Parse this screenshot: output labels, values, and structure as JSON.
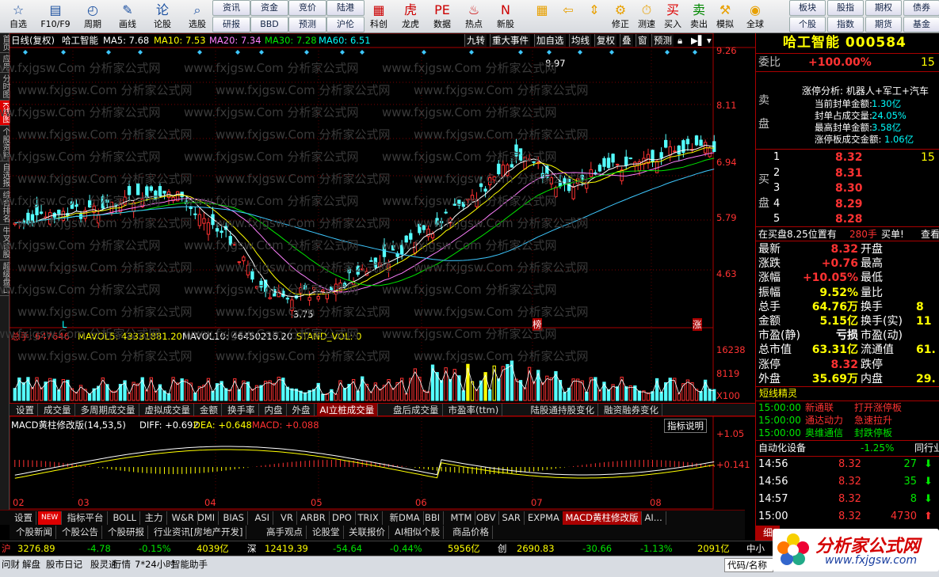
{
  "toolbar": {
    "buttons": [
      {
        "name": "自选",
        "icon": "star"
      },
      {
        "name": "F10/F9",
        "icon": "doc"
      },
      {
        "name": "周期",
        "icon": "clock"
      },
      {
        "name": "画线",
        "icon": "pen"
      },
      {
        "name": "论股",
        "icon": "chat"
      },
      {
        "name": "选股",
        "icon": "search"
      }
    ],
    "small_buttons": [
      "资讯",
      "资金",
      "竞价",
      "陆港",
      "研报",
      "BBD",
      "预测",
      "沪伦"
    ],
    "buttons2": [
      {
        "name": "科创",
        "icon": "chip"
      },
      {
        "name": "龙虎",
        "icon": "tiger"
      },
      {
        "name": "数据",
        "icon": "pe"
      },
      {
        "name": "热点",
        "icon": "fire"
      },
      {
        "name": "新股",
        "icon": "new"
      }
    ],
    "buttons3": [
      {
        "name": "",
        "icon": "grid"
      },
      {
        "name": "",
        "icon": "back"
      },
      {
        "name": "",
        "icon": "updown"
      },
      {
        "name": "修正",
        "icon": "fix"
      },
      {
        "name": "测速",
        "icon": "speed"
      },
      {
        "name": "买入",
        "icon": "buy"
      },
      {
        "name": "卖出",
        "icon": "sell"
      },
      {
        "name": "模拟",
        "icon": "hammer"
      },
      {
        "name": "全球",
        "icon": "globe"
      }
    ],
    "small_buttons2": [
      "板块",
      "股指",
      "期权",
      "债券",
      "个股",
      "指数",
      "期货",
      "基金"
    ]
  },
  "left_tabs": [
    "首页",
    "应用",
    "分时图",
    "K线图",
    "个股资料",
    "自选报",
    "综合排名",
    "牛叉诊股",
    "超级盘口"
  ],
  "chart_header": {
    "mode": "日线(复权)",
    "stock": "哈工智能",
    "ma5": "MA5: 7.68",
    "ma10": "MA10: 7.53",
    "ma20": "MA20: 7.34",
    "ma30": "MA30: 7.28",
    "ma60": "MA60: 6.51"
  },
  "chart_menu": [
    "九转",
    "重大事件",
    "加自选",
    "均线",
    "复权",
    "叠",
    "窗",
    "预测"
  ],
  "price_axis": [
    "9.26",
    "8.11",
    "6.94",
    "5.79",
    "4.63"
  ],
  "annotations": {
    "high": "8.97",
    "low": "3.75",
    "mark_l": "L",
    "mark_bang": "榜",
    "mark_zhang": "涨"
  },
  "volume_header": {
    "label": "总手:",
    "value": "647646",
    "mavol5": "MAVOL5: 43331881.20",
    "mavol10": "MAVOL10: 46450216.20",
    "stand": "STAND_VOL: 0"
  },
  "volume_axis": [
    "16238",
    "8119",
    "X100"
  ],
  "indicator_tabs": [
    "设置",
    "成交量",
    "多周期成交量",
    "虚拟成交量",
    "金额",
    "换手率",
    "内盘",
    "外盘",
    "AI立桩成交量",
    "盘后成交量",
    "市盈率(ttm)",
    "陆股通持股变化",
    "融资融券变化"
  ],
  "macd_header": {
    "title": "MACD黄柱修改版(14,53,5)",
    "diff": "DIFF: +0.692",
    "dea": "DEA: +0.648",
    "macd": "MACD: +0.088",
    "explain": "指标说明"
  },
  "macd_axis": [
    "+1.05",
    "+0.141"
  ],
  "month_labels": [
    "02",
    "03",
    "04",
    "05",
    "06",
    "07",
    "08"
  ],
  "bottom_tabs1": [
    "设置",
    "NEW",
    "指标平台",
    "BOLL",
    "主力",
    "W&R",
    "DMI",
    "BIAS",
    "ASI",
    "VR",
    "ARBR",
    "DPO",
    "TRIX",
    "新DMA",
    "BBI",
    "MTM",
    "OBV",
    "SAR",
    "EXPMA",
    "MACD黄柱修改版",
    "AI..."
  ],
  "bottom_tabs2": [
    "个股新闻",
    "个股公告",
    "个股研报",
    "行业资讯[房地产开发]",
    "高手观点",
    "论股堂",
    "关联报价",
    "AI相似个股",
    "商品价格"
  ],
  "index_bar": {
    "sh_label": "沪",
    "sh_value": "3276.89",
    "sh_change": "-4.78",
    "sh_pct": "-0.15%",
    "sh_amt": "4039亿",
    "sz_label": "深",
    "sz_value": "12419.39",
    "sz_change": "-54.64",
    "sz_pct": "-0.44%",
    "sz_amt": "5956亿",
    "cy_label": "创",
    "cy_value": "2690.83",
    "cy_change": "-30.66",
    "cy_pct": "-1.13%",
    "cy_amt": "2091亿",
    "more": "中小"
  },
  "bottom_bar": [
    "问财",
    "解盘",
    "股市日记",
    "股灵通",
    "行情",
    "7*24小时",
    "智能助手"
  ],
  "bottom_search": "代码/名称",
  "right": {
    "title": "哈工智能 000584",
    "weibi_label": "委比",
    "weibi": "+100.00%",
    "weibi_extra": "15",
    "zt_title": "涨停分析: 机器人+军工+汽车",
    "zt_lines": [
      [
        "当前封单金额:",
        "1.30亿"
      ],
      [
        "封单占成交量:",
        "24.05%"
      ],
      [
        "最高封单金额:",
        "3.58亿"
      ],
      [
        "涨停板成交金额:",
        "1.06亿"
      ]
    ],
    "sell_label": "卖盘",
    "buy_label": "买盘",
    "buy_rows": [
      {
        "lv": "1",
        "price": "8.32",
        "vol": "15"
      },
      {
        "lv": "2",
        "price": "8.31",
        "vol": ""
      },
      {
        "lv": "3",
        "price": "8.30",
        "vol": ""
      },
      {
        "lv": "4",
        "price": "8.29",
        "vol": ""
      },
      {
        "lv": "5",
        "price": "8.28",
        "vol": ""
      }
    ],
    "position": "在买盘8.25位置有",
    "position_vol": "280手",
    "position_act": "买单!",
    "position_more": "查看",
    "stats": [
      [
        "最新",
        "8.32",
        "开盘",
        ""
      ],
      [
        "涨跌",
        "+0.76",
        "最高",
        ""
      ],
      [
        "涨幅",
        "+10.05%",
        "最低",
        ""
      ],
      [
        "振幅",
        "9.52%",
        "量比",
        ""
      ],
      [
        "总手",
        "64.76万",
        "换手",
        "8"
      ],
      [
        "金额",
        "5.15亿",
        "换手(实)",
        "11"
      ],
      [
        "市盈(静)",
        "亏损",
        "市盈(动)",
        ""
      ],
      [
        "总市值",
        "63.31亿",
        "流通值",
        "61."
      ],
      [
        "涨停",
        "8.32",
        "跌停",
        ""
      ],
      [
        "外盘",
        "35.69万",
        "内盘",
        "29."
      ]
    ],
    "news_title": "短线精灵",
    "news": [
      [
        "15:00:00",
        "新通联",
        "打开涨停板"
      ],
      [
        "15:00:00",
        "通达动力",
        "急速拉升"
      ],
      [
        "15:00:00",
        "奥维通信",
        "封跌停板"
      ]
    ],
    "sector": "自动化设备",
    "sector_pct": "-1.25%",
    "sector_more": "同行业",
    "ticks": [
      [
        "14:56",
        "8.32",
        "27"
      ],
      [
        "14:56",
        "8.32",
        "35"
      ],
      [
        "14:57",
        "8.32",
        "8"
      ],
      [
        "15:00",
        "8.32",
        "4730"
      ]
    ],
    "tick_tab": "细"
  },
  "logo": {
    "text": "分析家公式网",
    "url": "www.fxjgsw.com"
  },
  "watermark": "www.fxjgsw.Com 分析家公式网"
}
